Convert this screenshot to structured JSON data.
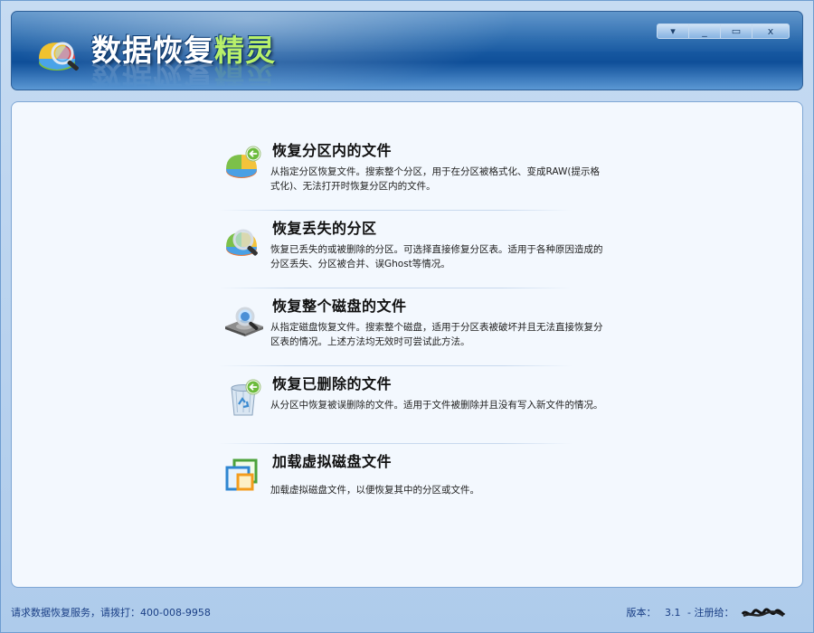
{
  "app": {
    "title_main": "数据恢复",
    "title_accent": "精灵"
  },
  "window_controls": {
    "menu_glyph": "▾",
    "minimize_glyph": "_",
    "maximize_glyph": "▭",
    "close_glyph": "x"
  },
  "menu": [
    {
      "title": "恢复分区内的文件",
      "desc": "从指定分区恢复文件。搜索整个分区，用于在分区被格式化、变成RAW(提示格式化)、无法打开时恢复分区内的文件。",
      "icon": "partition-files-icon"
    },
    {
      "title": "恢复丢失的分区",
      "desc": "恢复已丢失的或被删除的分区。可选择直接修复分区表。适用于各种原因造成的分区丢失、分区被合并、误Ghost等情况。",
      "icon": "lost-partition-icon"
    },
    {
      "title": "恢复整个磁盘的文件",
      "desc": "从指定磁盘恢复文件。搜索整个磁盘，适用于分区表被破坏并且无法直接恢复分区表的情况。上述方法均无效时可尝试此方法。",
      "icon": "disk-search-icon"
    },
    {
      "title": "恢复已删除的文件",
      "desc": "从分区中恢复被误删除的文件。适用于文件被删除并且没有写入新文件的情况。",
      "icon": "recycle-bin-icon"
    },
    {
      "title": "加载虚拟磁盘文件",
      "desc": "加载虚拟磁盘文件，以便恢复其中的分区或文件。",
      "icon": "virtual-disk-icon"
    }
  ],
  "status": {
    "service_text": "请求数据恢复服务，请拨打：400-008-9958",
    "version_label": "版本：",
    "version_value": "3.1",
    "registered_label": "- 注册给："
  },
  "colors": {
    "header_dark": "#0f4f99",
    "header_light": "#3e7fc0",
    "title_accent": "#b8f06a",
    "panel_bg": "#f3f8fe",
    "status_text": "#1a3f85"
  }
}
